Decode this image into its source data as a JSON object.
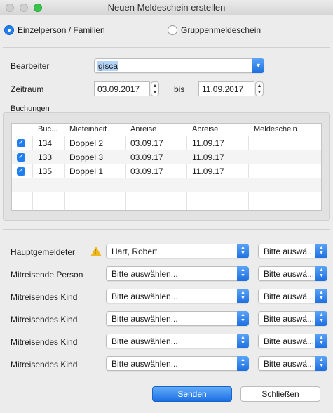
{
  "window": {
    "title": "Neuen Meldeschein erstellen"
  },
  "mode": {
    "option1": "Einzelperson / Familien",
    "option2": "Gruppenmeldeschein",
    "selected": "option1"
  },
  "form": {
    "bearbeiter_label": "Bearbeiter",
    "bearbeiter_value": "gisca",
    "zeitraum_label": "Zeitraum",
    "from_date": "03.09.2017",
    "bis_label": "bis",
    "to_date": "11.09.2017"
  },
  "bookings": {
    "section_label": "Buchungen",
    "columns": [
      "Buc...",
      "Mieteinheit",
      "Anreise",
      "Abreise",
      "Meldeschein"
    ],
    "rows": [
      {
        "checked": true,
        "number": "134",
        "unit": "Doppel 2",
        "arrival": "03.09.17",
        "departure": "11.09.17",
        "form": ""
      },
      {
        "checked": true,
        "number": "133",
        "unit": "Doppel 3",
        "arrival": "03.09.17",
        "departure": "11.09.17",
        "form": ""
      },
      {
        "checked": true,
        "number": "135",
        "unit": "Doppel 1",
        "arrival": "03.09.17",
        "departure": "11.09.17",
        "form": ""
      }
    ]
  },
  "guests": {
    "rows": [
      {
        "label": "Hauptgemeldeter",
        "person": "Hart, Robert",
        "option": "Bitte auswä...",
        "warning": true
      },
      {
        "label": "Mitreisende Person",
        "person": "Bitte auswählen...",
        "option": "Bitte auswä...",
        "warning": false
      },
      {
        "label": "Mitreisendes Kind",
        "person": "Bitte auswählen...",
        "option": "Bitte auswä...",
        "warning": false
      },
      {
        "label": "Mitreisendes Kind",
        "person": "Bitte auswählen...",
        "option": "Bitte auswä...",
        "warning": false
      },
      {
        "label": "Mitreisendes Kind",
        "person": "Bitte auswählen...",
        "option": "Bitte auswä...",
        "warning": false
      },
      {
        "label": "Mitreisendes Kind",
        "person": "Bitte auswählen...",
        "option": "Bitte auswä...",
        "warning": false
      }
    ]
  },
  "buttons": {
    "send": "Senden",
    "close": "Schließen"
  },
  "icons": {
    "warning": "warning-icon",
    "checkbox": "checkmark-icon"
  },
  "colors": {
    "accent": "#1f7ef0",
    "warning": "#f1b81b"
  }
}
